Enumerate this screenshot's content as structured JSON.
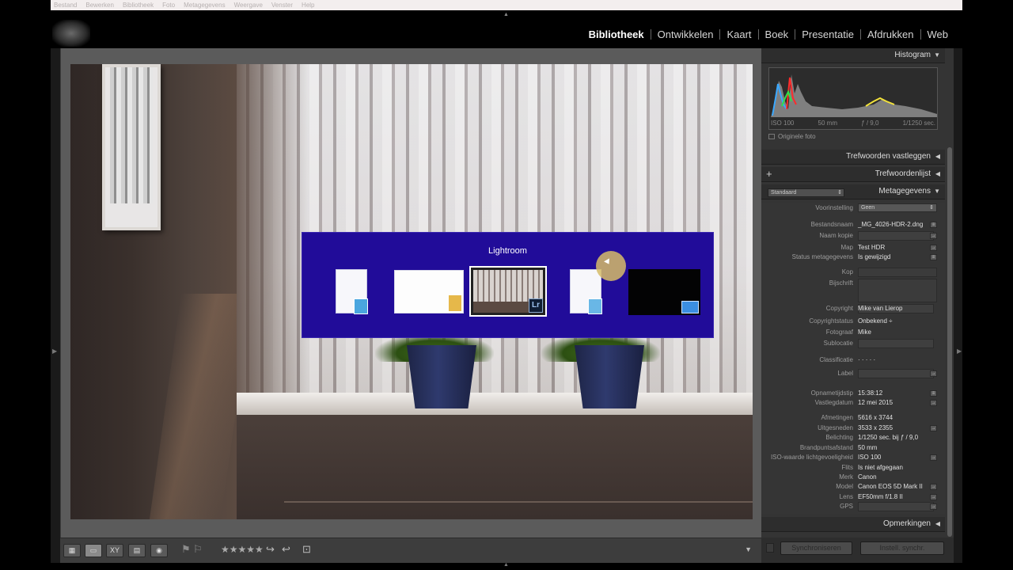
{
  "menubar": [
    "Bestand",
    "Bewerken",
    "Bibliotheek",
    "Foto",
    "Metagegevens",
    "Weergave",
    "Venster",
    "Help"
  ],
  "modules": {
    "active": "Bibliotheek",
    "items": [
      "Bibliotheek",
      "Ontwikkelen",
      "Kaart",
      "Boek",
      "Presentatie",
      "Afdrukken",
      "Web"
    ]
  },
  "switcher": {
    "title": "Lightroom",
    "lr_badge": "Lr"
  },
  "toolbar": {
    "stars": "★★★★★"
  },
  "panels": {
    "histogram": "Histogram",
    "keywording": "Trefwoorden vastleggen",
    "keyword_list": "Trefwoordenlijst",
    "metadata": "Metagegevens",
    "comments": "Opmerkingen",
    "metadata_preset_select": "Standaard",
    "add_symbol": "+"
  },
  "histogram": {
    "iso": "ISO 100",
    "focal": "50 mm",
    "aperture": "ƒ / 9,0",
    "shutter": "1/1250 sec.",
    "original_photo": "Originele foto"
  },
  "metadata": {
    "preset_label": "Voorinstelling",
    "preset_value": "Geen",
    "rows": [
      {
        "label": "Bestandsnaam",
        "value": "_MG_4026-HDR-2.dng"
      },
      {
        "label": "Naam kopie",
        "value": ""
      },
      {
        "label": "Map",
        "value": "Test HDR"
      },
      {
        "label": "Status metagegevens",
        "value": "Is gewijzigd"
      },
      {
        "label": "Kop",
        "value": ""
      },
      {
        "label": "Bijschrift",
        "value": ""
      },
      {
        "label": "Copyright",
        "value": "Mike van Lierop"
      },
      {
        "label": "Copyrightstatus",
        "value": "Onbekend ÷"
      },
      {
        "label": "Fotograaf",
        "value": "Mike"
      },
      {
        "label": "Sublocatie",
        "value": ""
      },
      {
        "label": "Classificatie",
        "value": "·  ·  ·  ·  ·"
      },
      {
        "label": "Label",
        "value": ""
      },
      {
        "label": "Opnametijdstip",
        "value": "15:38:12"
      },
      {
        "label": "Vastlegdatum",
        "value": "12 mei 2015"
      },
      {
        "label": "Afmetingen",
        "value": "5616 x 3744"
      },
      {
        "label": "Uitgesneden",
        "value": "3533 x 2355"
      },
      {
        "label": "Belichting",
        "value": "1/1250 sec. bij ƒ / 9,0"
      },
      {
        "label": "Brandpuntsafstand",
        "value": "50 mm"
      },
      {
        "label": "ISO-waarde lichtgevoeligheid",
        "value": "ISO 100"
      },
      {
        "label": "Flits",
        "value": "Is niet afgegaan"
      },
      {
        "label": "Merk",
        "value": "Canon"
      },
      {
        "label": "Model",
        "value": "Canon EOS 5D Mark II"
      },
      {
        "label": "Lens",
        "value": "EF50mm f/1.8 II"
      },
      {
        "label": "GPS",
        "value": ""
      }
    ]
  },
  "sync": {
    "sync_label": "Synchroniseren",
    "settings_sync_label": "Instell. synchr."
  },
  "colors": {
    "switcher_bg": "#210c99",
    "panel_bg": "#343434",
    "center_bg": "#5b5b5b"
  }
}
